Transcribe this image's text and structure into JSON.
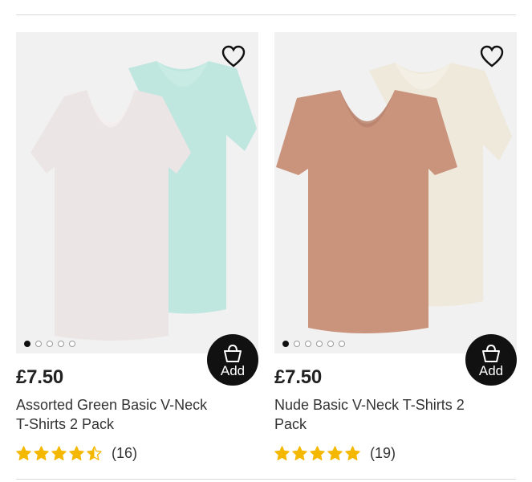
{
  "products": [
    {
      "price": "£7.50",
      "title": "Assorted Green Basic V-Neck T-Shirts 2 Pack",
      "rating": 4.5,
      "review_count": "(16)",
      "add_label": "Add",
      "images_total": 5,
      "active_image": 1,
      "colors": {
        "front": "#ece5e6",
        "back": "#bfe6df",
        "collar_front": "#f6efef",
        "collar_back": "#cfeee8"
      }
    },
    {
      "price": "£7.50",
      "title": "Nude Basic V-Neck T-Shirts 2 Pack",
      "rating": 5,
      "review_count": "(19)",
      "add_label": "Add",
      "images_total": 6,
      "active_image": 1,
      "colors": {
        "front": "#c9937c",
        "back": "#efe9dc",
        "collar_front": "#b9826d",
        "collar_back": "#f7f3ea"
      }
    }
  ],
  "icons": {
    "wishlist": "heart-outline-icon",
    "add": "shopping-basket-icon",
    "star": "star-icon"
  },
  "theme": {
    "star_color": "#f5b800",
    "button_color": "#111111"
  }
}
